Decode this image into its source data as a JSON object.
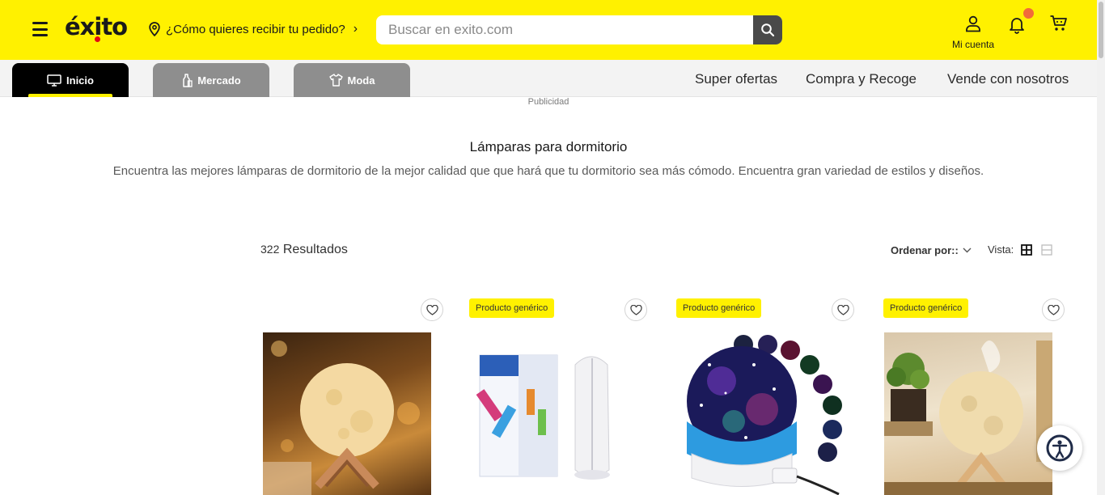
{
  "header": {
    "logo_text": "éxito",
    "delivery_prompt": "¿Cómo quieres recibir tu pedido?",
    "search_placeholder": "Buscar en exito.com",
    "account_label": "Mi cuenta",
    "brand_color": "#fff100"
  },
  "nav": {
    "tabs": [
      {
        "label": "Inicio",
        "icon": "monitor-icon",
        "active": true
      },
      {
        "label": "Mercado",
        "icon": "bottle-icon",
        "active": false
      },
      {
        "label": "Moda",
        "icon": "shirt-icon",
        "active": false
      }
    ],
    "links": [
      "Super ofertas",
      "Compra y Recoge",
      "Vende con nosotros"
    ]
  },
  "ad_label": "Publicidad",
  "category": {
    "title": "Lámparas para dormitorio",
    "description": "Encuentra las mejores lámparas de dormitorio de la mejor calidad que que hará que tu dormitorio sea más cómodo. Encuentra gran variedad de estilos y diseños."
  },
  "results": {
    "count": "322",
    "label": "Resultados",
    "sort_label": "Ordenar por::",
    "view_label": "Vista:"
  },
  "products": [
    {
      "badge": "",
      "image": "moon-lamp-on-wooden-stand"
    },
    {
      "badge": "Producto genérico",
      "image": "folding-led-lamp-with-box"
    },
    {
      "badge": "Producto genérico",
      "image": "star-projector-lamp"
    },
    {
      "badge": "Producto genérico",
      "image": "moon-lamp-humidifier"
    }
  ]
}
